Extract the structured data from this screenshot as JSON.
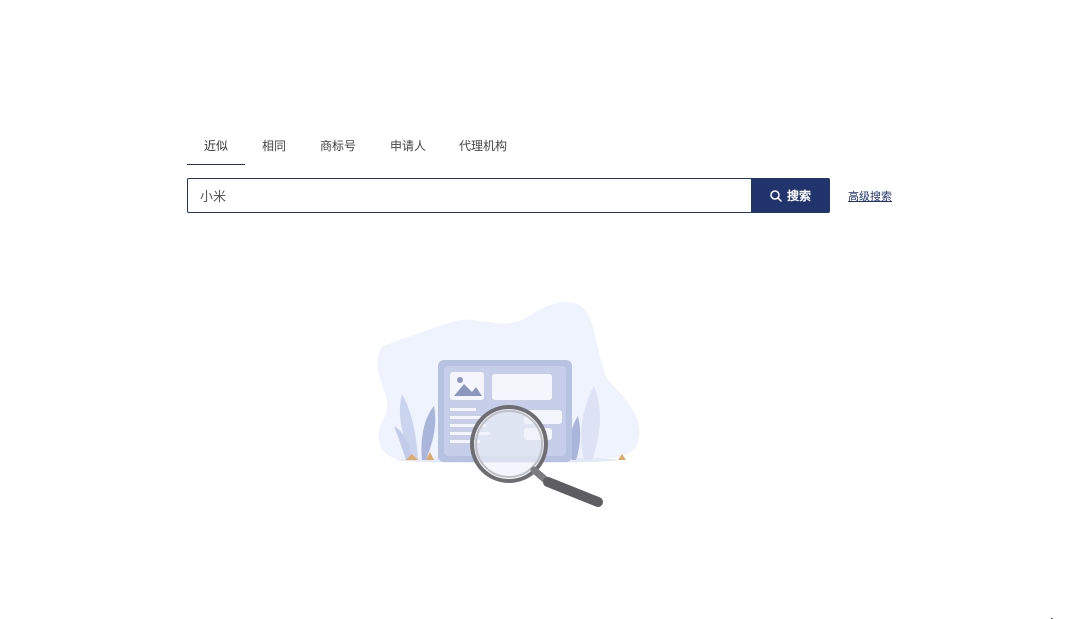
{
  "tabs": [
    {
      "label": "近似",
      "active": true
    },
    {
      "label": "相同",
      "active": false
    },
    {
      "label": "商标号",
      "active": false
    },
    {
      "label": "申请人",
      "active": false
    },
    {
      "label": "代理机构",
      "active": false
    }
  ],
  "search": {
    "value": "小米",
    "button_label": "搜索",
    "advanced_label": "高级搜索"
  },
  "colors": {
    "accent": "#22346d",
    "illustration_bg": "#eef3fd",
    "illustration_card": "#b7c1e0"
  },
  "icons": {
    "search": "search-icon",
    "empty_state": "empty-search-illustration",
    "cursor": "mouse-cursor-icon"
  }
}
